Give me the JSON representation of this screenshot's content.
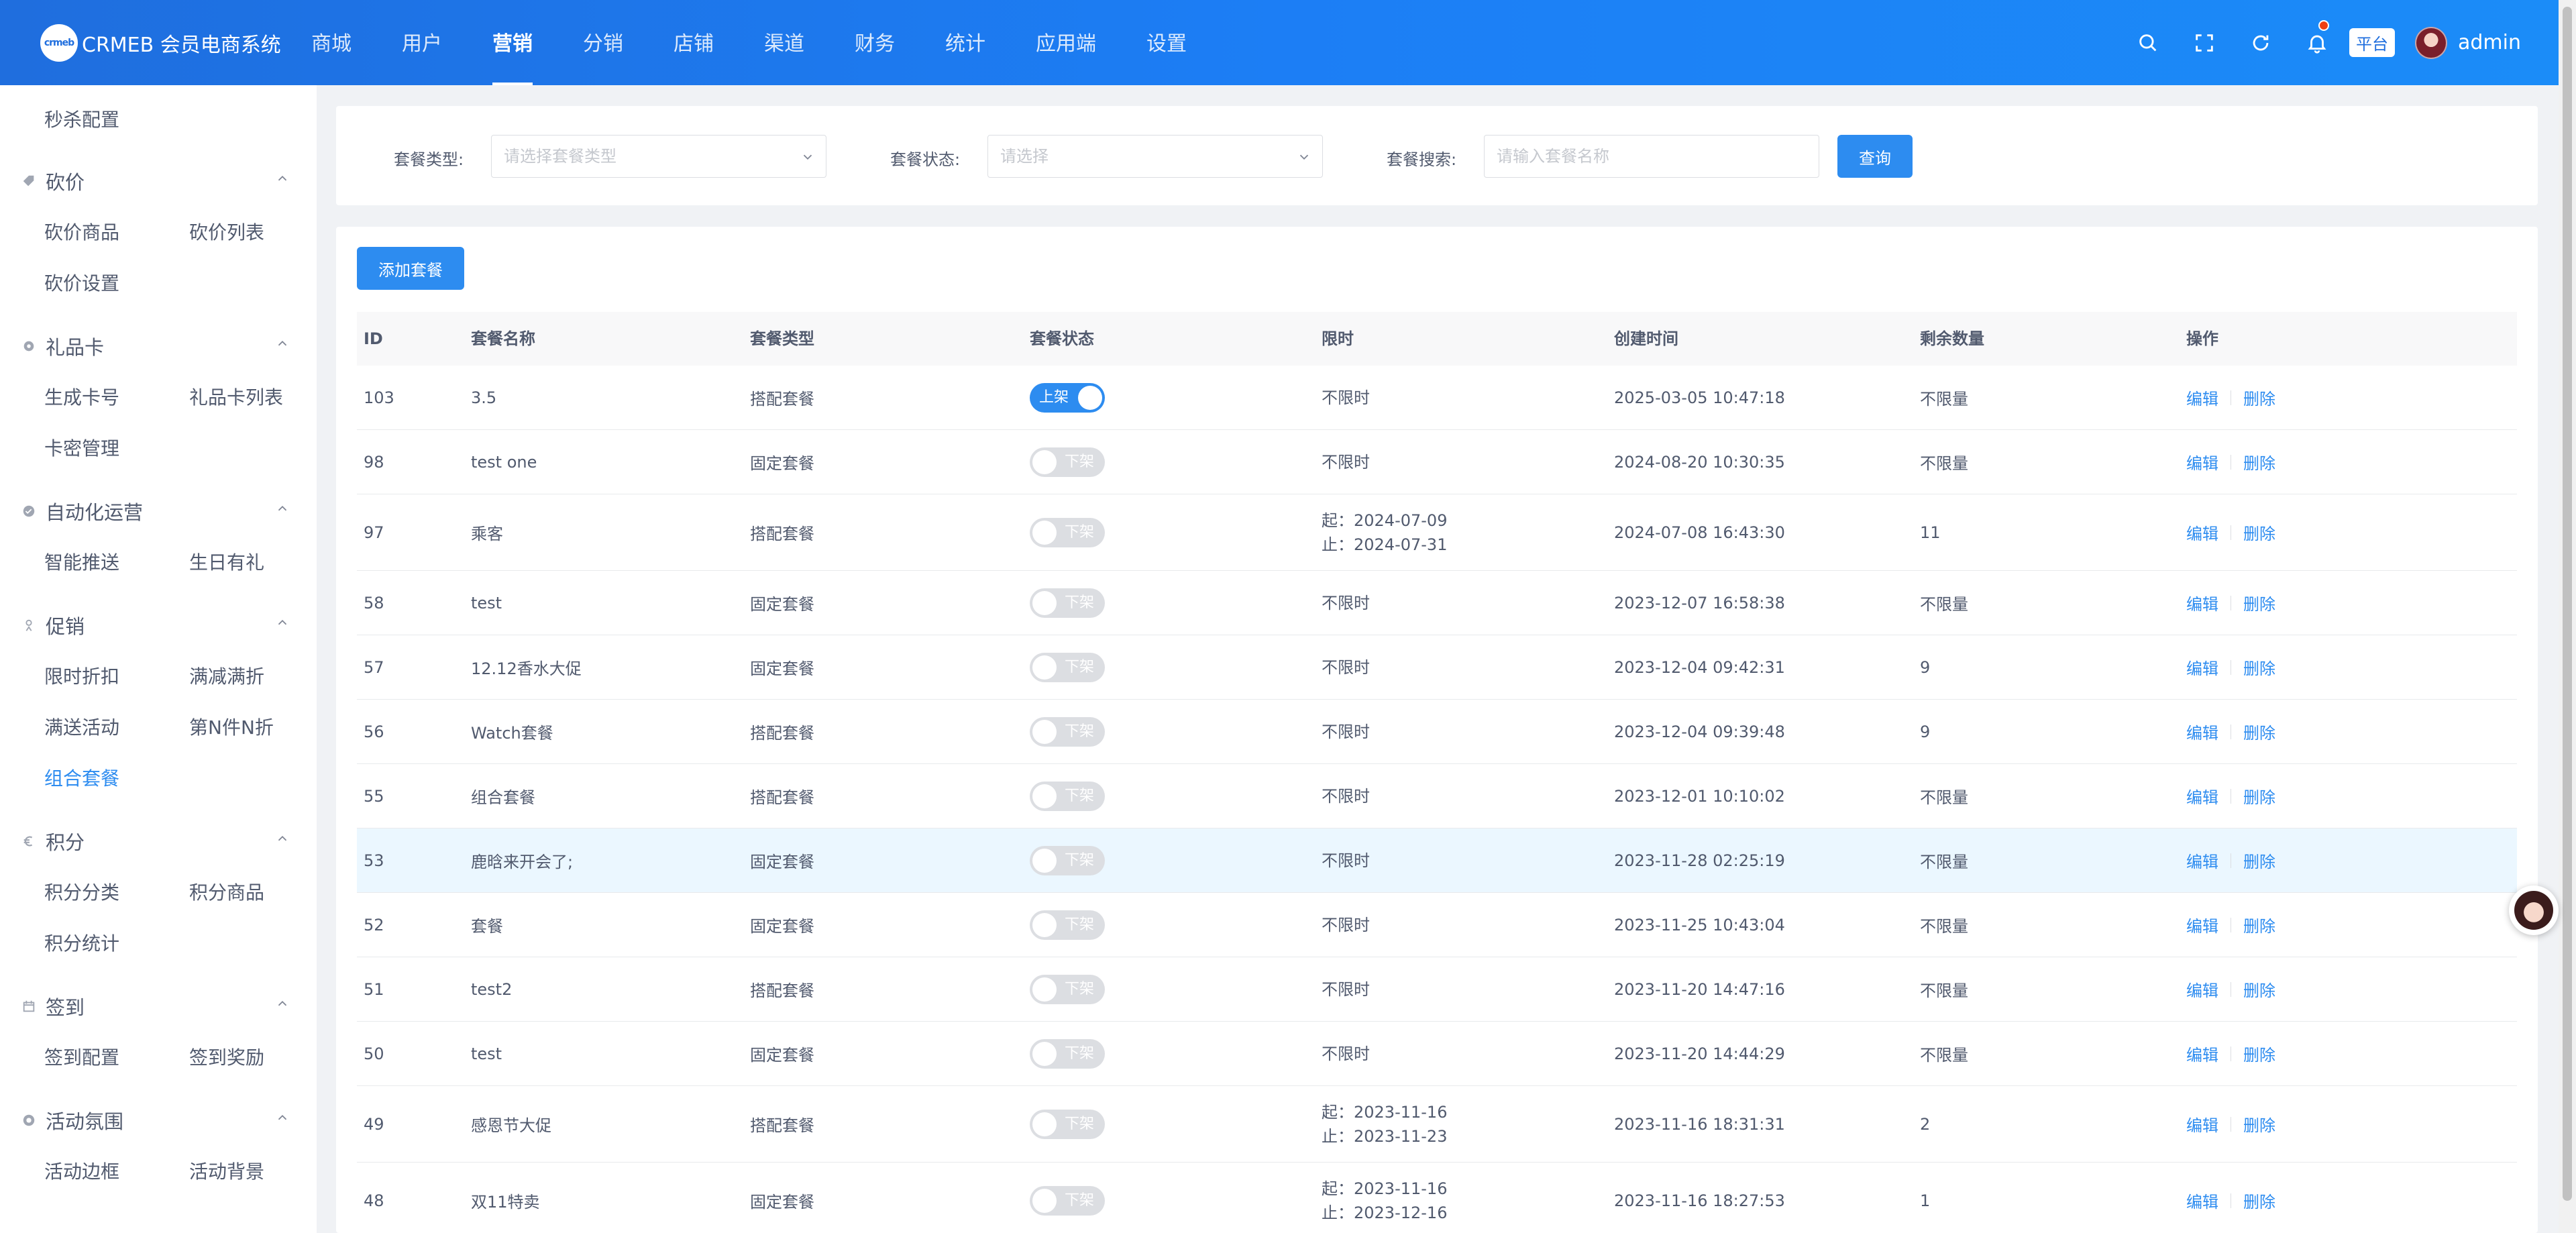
{
  "header": {
    "logo_mark": "crmeb",
    "logo_text": "CRMEB 会员电商系统",
    "nav": [
      "商城",
      "用户",
      "营销",
      "分销",
      "店铺",
      "渠道",
      "财务",
      "统计",
      "应用端",
      "设置"
    ],
    "active_nav_index": 2,
    "platform_badge": "平台",
    "admin_name": "admin",
    "icons": [
      "search-icon",
      "fullscreen-icon",
      "refresh-icon",
      "bell-icon"
    ]
  },
  "sidebar": {
    "top_link": "秒杀配置",
    "groups": [
      {
        "title": "砍价",
        "items": [
          "砍价商品",
          "砍价列表",
          "砍价设置"
        ]
      },
      {
        "title": "礼品卡",
        "items": [
          "生成卡号",
          "礼品卡列表",
          "卡密管理"
        ]
      },
      {
        "title": "自动化运营",
        "items": [
          "智能推送",
          "生日有礼"
        ]
      },
      {
        "title": "促销",
        "items": [
          "限时折扣",
          "满减满折",
          "满送活动",
          "第N件N折",
          "组合套餐"
        ]
      },
      {
        "title": "积分",
        "items": [
          "积分分类",
          "积分商品",
          "积分统计"
        ]
      },
      {
        "title": "签到",
        "items": [
          "签到配置",
          "签到奖励"
        ]
      },
      {
        "title": "活动氛围",
        "items": [
          "活动边框",
          "活动背景"
        ]
      }
    ],
    "active_item": "组合套餐"
  },
  "filters": {
    "type_label": "套餐类型:",
    "type_placeholder": "请选择套餐类型",
    "status_label": "套餐状态:",
    "status_placeholder": "请选择",
    "search_label": "套餐搜索:",
    "search_placeholder": "请输入套餐名称",
    "query_button": "查询"
  },
  "table": {
    "add_button": "添加套餐",
    "columns": [
      "ID",
      "套餐名称",
      "套餐类型",
      "套餐状态",
      "限时",
      "创建时间",
      "剩余数量",
      "操作"
    ],
    "edit_label": "编辑",
    "delete_label": "删除",
    "switch_on_label": "上架",
    "switch_off_label": "下架",
    "rows": [
      {
        "id": "103",
        "name": "3.5",
        "type": "搭配套餐",
        "on": true,
        "limit": [
          "不限时"
        ],
        "created": "2025-03-05 10:47:18",
        "remain": "不限量"
      },
      {
        "id": "98",
        "name": "test one",
        "type": "固定套餐",
        "on": false,
        "limit": [
          "不限时"
        ],
        "created": "2024-08-20 10:30:35",
        "remain": "不限量"
      },
      {
        "id": "97",
        "name": "乘客",
        "type": "搭配套餐",
        "on": false,
        "limit": [
          "起：2024-07-09",
          "止：2024-07-31"
        ],
        "created": "2024-07-08 16:43:30",
        "remain": "11"
      },
      {
        "id": "58",
        "name": "test",
        "type": "固定套餐",
        "on": false,
        "limit": [
          "不限时"
        ],
        "created": "2023-12-07 16:58:38",
        "remain": "不限量"
      },
      {
        "id": "57",
        "name": "12.12香水大促",
        "type": "固定套餐",
        "on": false,
        "limit": [
          "不限时"
        ],
        "created": "2023-12-04 09:42:31",
        "remain": "9"
      },
      {
        "id": "56",
        "name": "Watch套餐",
        "type": "搭配套餐",
        "on": false,
        "limit": [
          "不限时"
        ],
        "created": "2023-12-04 09:39:48",
        "remain": "9"
      },
      {
        "id": "55",
        "name": "组合套餐",
        "type": "搭配套餐",
        "on": false,
        "limit": [
          "不限时"
        ],
        "created": "2023-12-01 10:10:02",
        "remain": "不限量"
      },
      {
        "id": "53",
        "name": "鹿晗来开会了;",
        "type": "固定套餐",
        "on": false,
        "limit": [
          "不限时"
        ],
        "created": "2023-11-28 02:25:19",
        "remain": "不限量"
      },
      {
        "id": "52",
        "name": "套餐",
        "type": "固定套餐",
        "on": false,
        "limit": [
          "不限时"
        ],
        "created": "2023-11-25 10:43:04",
        "remain": "不限量"
      },
      {
        "id": "51",
        "name": "test2",
        "type": "搭配套餐",
        "on": false,
        "limit": [
          "不限时"
        ],
        "created": "2023-11-20 14:47:16",
        "remain": "不限量"
      },
      {
        "id": "50",
        "name": "test",
        "type": "固定套餐",
        "on": false,
        "limit": [
          "不限时"
        ],
        "created": "2023-11-20 14:44:29",
        "remain": "不限量"
      },
      {
        "id": "49",
        "name": "感恩节大促",
        "type": "搭配套餐",
        "on": false,
        "limit": [
          "起：2023-11-16",
          "止：2023-11-23"
        ],
        "created": "2023-11-16 18:31:31",
        "remain": "2"
      },
      {
        "id": "48",
        "name": "双11特卖",
        "type": "固定套餐",
        "on": false,
        "limit": [
          "起：2023-11-16",
          "止：2023-12-16"
        ],
        "created": "2023-11-16 18:27:53",
        "remain": "1"
      }
    ]
  },
  "colors": {
    "primary": "#2d8cf0",
    "header": "#1c7ef5",
    "switch_off": "#dcdee2"
  }
}
